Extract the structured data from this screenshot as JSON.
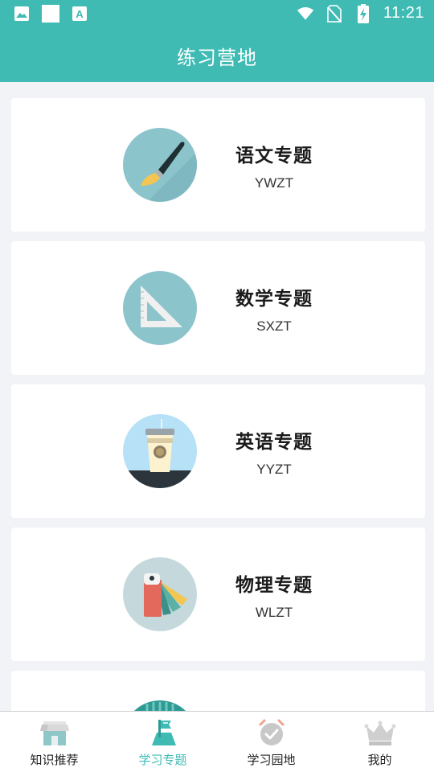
{
  "status_bar": {
    "time": "11:21",
    "left_icons": [
      "image-icon",
      "blank-notification-icon",
      "text-a-icon"
    ],
    "right_icons": [
      "wifi-icon",
      "no-sim-icon",
      "battery-charging-icon"
    ]
  },
  "app_bar": {
    "title": "练习营地"
  },
  "topics": [
    {
      "title": "语文专题",
      "code": "YWZT",
      "icon": "paintbrush-icon",
      "circle_color": "#8cc4cc"
    },
    {
      "title": "数学专题",
      "code": "SXZT",
      "icon": "set-square-icon",
      "circle_color": "#8cc4cc"
    },
    {
      "title": "英语专题",
      "code": "YYZT",
      "icon": "coffee-cup-icon",
      "circle_color": "#b6e1f7"
    },
    {
      "title": "物理专题",
      "code": "WLZT",
      "icon": "color-swatch-icon",
      "circle_color": "#c5d9dc"
    },
    {
      "title": "",
      "code": "",
      "icon": "partial-topic-icon",
      "circle_color": "#2f9a94"
    }
  ],
  "bottom_nav": {
    "items": [
      {
        "label": "知识推荐",
        "icon": "shop-icon",
        "active": false
      },
      {
        "label": "学习专题",
        "icon": "flag-icon",
        "active": true
      },
      {
        "label": "学习园地",
        "icon": "alarm-clock-icon",
        "active": false
      },
      {
        "label": "我的",
        "icon": "crown-icon",
        "active": false
      }
    ]
  },
  "colors": {
    "primary": "#3fbbb4",
    "background": "#f2f3f7",
    "card": "#ffffff",
    "nav_inactive_icon": "#c8c8c8"
  }
}
